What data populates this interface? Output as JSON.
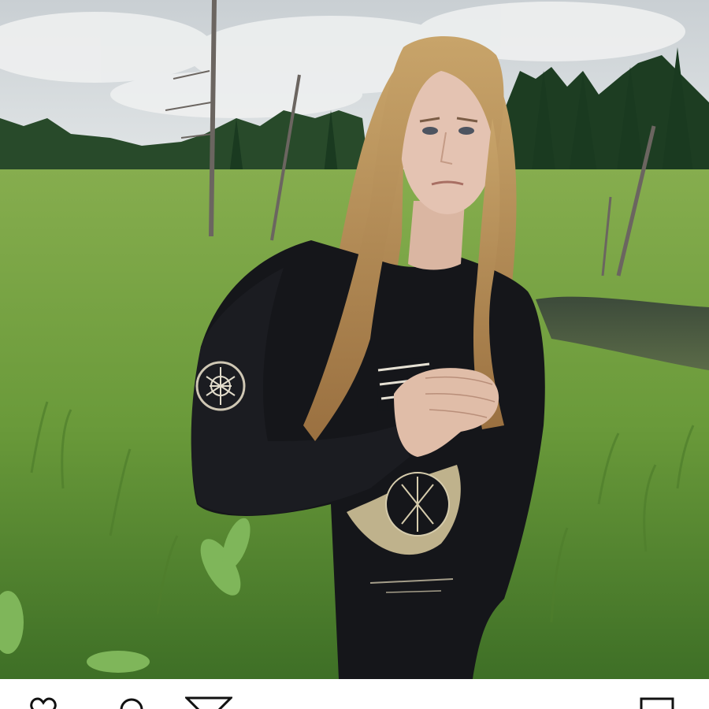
{
  "post": {
    "photo": {
      "alt": "",
      "colors": {
        "sky": "#d3d8da",
        "clouds": "#e9ecec",
        "forest": "#1f4224",
        "meadow": "#6f9d3e",
        "shirt": "#141518",
        "hair": "#b08a52",
        "skin": "#e2c0ae"
      }
    },
    "actions": {
      "icons": [
        "heart-icon",
        "comment-icon",
        "share-icon",
        "bookmark-icon"
      ],
      "icon_color": "#111111"
    }
  }
}
